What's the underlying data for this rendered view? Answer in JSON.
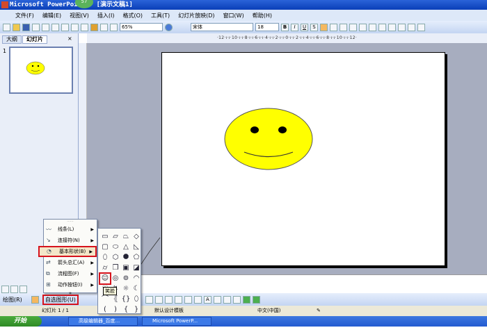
{
  "window": {
    "title": "Microsoft PowerPoint - [演示文稿1]",
    "badge": "57"
  },
  "menubar": [
    "文件(F)",
    "编辑(E)",
    "视图(V)",
    "插入(I)",
    "格式(O)",
    "工具(T)",
    "幻灯片放映(D)",
    "窗口(W)",
    "帮助(H)"
  ],
  "toolbar": {
    "zoom": "65%",
    "font": "宋体",
    "size": "18",
    "bold": "B",
    "italic": "I",
    "underline": "U",
    "shadow": "S"
  },
  "panel": {
    "tab_outline": "大纲",
    "tab_slides": "幻灯片",
    "close": "×",
    "slide_number": "1"
  },
  "ruler": "·12·ı·ı·10·ı·ı·8·ı·ı·6·ı·ı·4·ı·ı·2·ı·ı·0·ı·ı·2·ı·ı·4·ı·ı·6·ı·ı·8·ı·ı·10·ı·ı·12·",
  "slide": {
    "shape": "smiley-face",
    "fill": "#ffff00"
  },
  "autoshape_menu": {
    "items": [
      {
        "label": "线条(L)",
        "icon": "lines-icon"
      },
      {
        "label": "连接符(N)",
        "icon": "connector-icon"
      },
      {
        "label": "基本形状(B)",
        "icon": "basic-shapes-icon",
        "highlighted": true
      },
      {
        "label": "箭头总汇(A)",
        "icon": "block-arrows-icon"
      },
      {
        "label": "流程图(F)",
        "icon": "flowchart-icon"
      },
      {
        "label": "动作按钮(I)",
        "icon": "action-buttons-icon"
      }
    ],
    "more": "»"
  },
  "basic_shapes": [
    "▭",
    "▱",
    "⏢",
    "◇",
    "▢",
    "⬭",
    "△",
    "◺",
    "⬯",
    "⬡",
    "⯃",
    "⬠",
    "⌭",
    "❒",
    "▣",
    "◪",
    "☺",
    "◎",
    "⊚",
    "◠",
    "♡",
    "↯",
    "☼",
    "☾",
    "⌒",
    "⦃",
    "{}",
    "⬯",
    "(",
    ")",
    "{",
    "}"
  ],
  "tooltip": "笑脸",
  "drawbar": {
    "draw": "绘图(R)",
    "autoshapes": "自选图形(U)"
  },
  "status": {
    "slide": "幻灯片 1 / 1",
    "template": "默认设计模板",
    "language": "中文(中国)"
  },
  "taskbar": {
    "start": "开始",
    "tasks": [
      "高级编辑器_百度...",
      "Microsoft PowerP..."
    ]
  }
}
